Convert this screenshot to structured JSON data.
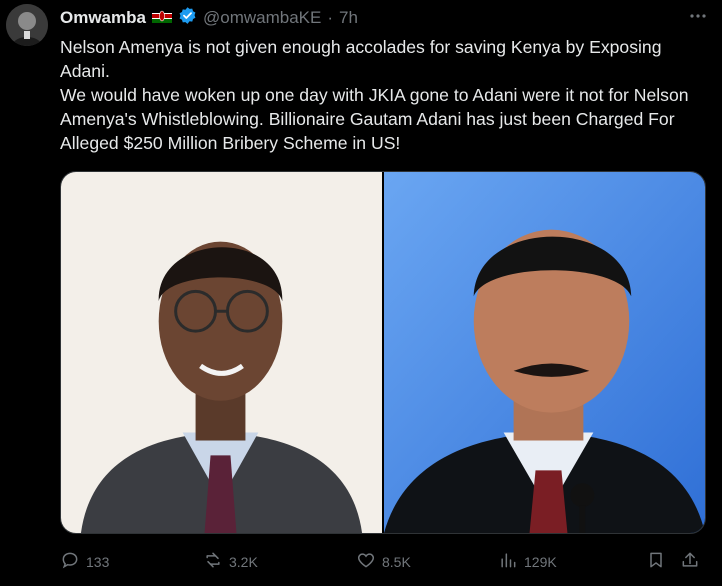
{
  "tweet": {
    "author_name": "Omwamba",
    "handle": "@omwambaKE",
    "separator": "·",
    "time": "7h",
    "text_lines": [
      "Nelson Amenya is not given enough accolades for saving Kenya by Exposing Adani.",
      "We would have woken up one day with JKIA gone to Adani were it not for Nelson Amenya's Whistleblowing. Billionaire Gautam Adani has just been Charged For Alleged $250 Million Bribery Scheme in US!"
    ]
  },
  "actions": {
    "replies": "133",
    "reposts": "3.2K",
    "likes": "8.5K",
    "views": "129K"
  },
  "icons": {
    "flag": "kenya-flag-icon",
    "verified": "verified-badge-icon",
    "more": "more-options-icon",
    "reply": "reply-icon",
    "repost": "repost-icon",
    "like": "like-icon",
    "views": "views-icon",
    "bookmark": "bookmark-icon",
    "share": "share-icon"
  },
  "colors": {
    "background": "#000000",
    "text": "#e7e9ea",
    "muted": "#71767b",
    "verified": "#1d9bf0"
  }
}
